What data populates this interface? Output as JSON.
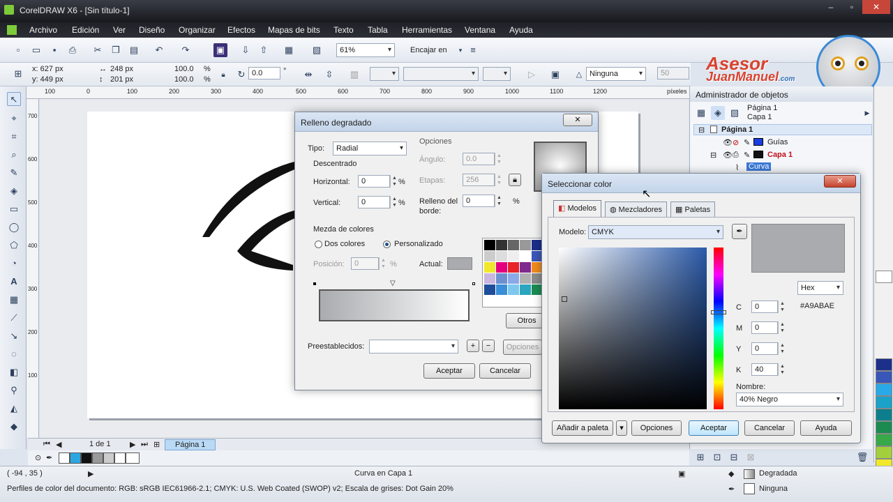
{
  "window": {
    "title": "CorelDRAW X6 - [Sin título-1]"
  },
  "menu": [
    "Archivo",
    "Edición",
    "Ver",
    "Diseño",
    "Organizar",
    "Efectos",
    "Mapas de bits",
    "Texto",
    "Tabla",
    "Herramientas",
    "Ventana",
    "Ayuda"
  ],
  "toolbar": {
    "zoom": "61%",
    "snap_label": "Encajar en"
  },
  "propbar": {
    "x": "x: 627 px",
    "y": "y: 449 px",
    "w": "248 px",
    "h": "201 px",
    "sx": "100.0",
    "sy": "100.0",
    "pct": "%",
    "angle": "0.0",
    "outline": "Ninguna",
    "num50": "50"
  },
  "ruler": {
    "ticks": [
      "100",
      "0",
      "100",
      "200",
      "300",
      "400",
      "500",
      "600",
      "700",
      "800",
      "900",
      "1000",
      "1100",
      "1200"
    ],
    "unit": "píxeles",
    "vticks": [
      "700",
      "600",
      "500",
      "400",
      "300",
      "200",
      "100"
    ]
  },
  "watermark": {
    "line1": "Asesor",
    "line2": "JuanManuel",
    "suffix": ".com"
  },
  "docker": {
    "title": "Administrador de objetos",
    "page": "Página 1",
    "layer": "Capa 1",
    "tree": {
      "page": "Página 1",
      "guides": "Guías",
      "layer": "Capa 1",
      "curve": "Curva"
    }
  },
  "gradient_dialog": {
    "title": "Relleno degradado",
    "type_label": "Tipo:",
    "type_value": "Radial",
    "offset_label": "Descentrado",
    "horizontal_label": "Horizontal:",
    "horizontal_value": "0",
    "vertical_label": "Vertical:",
    "vertical_value": "0",
    "options_label": "Opciones",
    "angle_label": "Ángulo:",
    "angle_value": "0.0",
    "steps_label": "Etapas:",
    "steps_value": "256",
    "edge_label_1": "Relleno del",
    "edge_label_2": "borde:",
    "edge_value": "0",
    "blend_label": "Mezda de colores",
    "two_colors": "Dos colores",
    "custom": "Personalizado",
    "position_label": "Posición:",
    "position_value": "0",
    "current_label": "Actual:",
    "others": "Otros",
    "presets_label": "Preestablecidos:",
    "preset_options": "Opciones",
    "ok": "Aceptar",
    "cancel": "Cancelar",
    "pct": "%"
  },
  "color_dialog": {
    "title": "Seleccionar color",
    "tabs": [
      "Modelos",
      "Mezcladores",
      "Paletas"
    ],
    "model_label": "Modelo:",
    "model_value": "CMYK",
    "format_value": "Hex",
    "c_label": "C",
    "c_value": "0",
    "m_label": "M",
    "m_value": "0",
    "y_label": "Y",
    "y_value": "0",
    "k_label": "K",
    "k_value": "40",
    "hex_value": "#A9ABAE",
    "name_label": "Nombre:",
    "name_value": "40% Negro",
    "add_palette": "Añadir a paleta",
    "options": "Opciones",
    "ok": "Aceptar",
    "cancel": "Cancelar",
    "help": "Ayuda",
    "swatch_color": "#A9ABAE"
  },
  "nav": {
    "pages": "1 de 1",
    "tab": "Página 1"
  },
  "status": {
    "coords": "( -94 , 35 )",
    "object": "Curva en Capa 1",
    "profiles": "Perfiles de color del documento: RGB: sRGB IEC61966-2.1; CMYK: U.S. Web Coated (SWOP) v2; Escala de grises: Dot Gain 20%",
    "fill": "Degradada",
    "outline": "Ninguna"
  }
}
